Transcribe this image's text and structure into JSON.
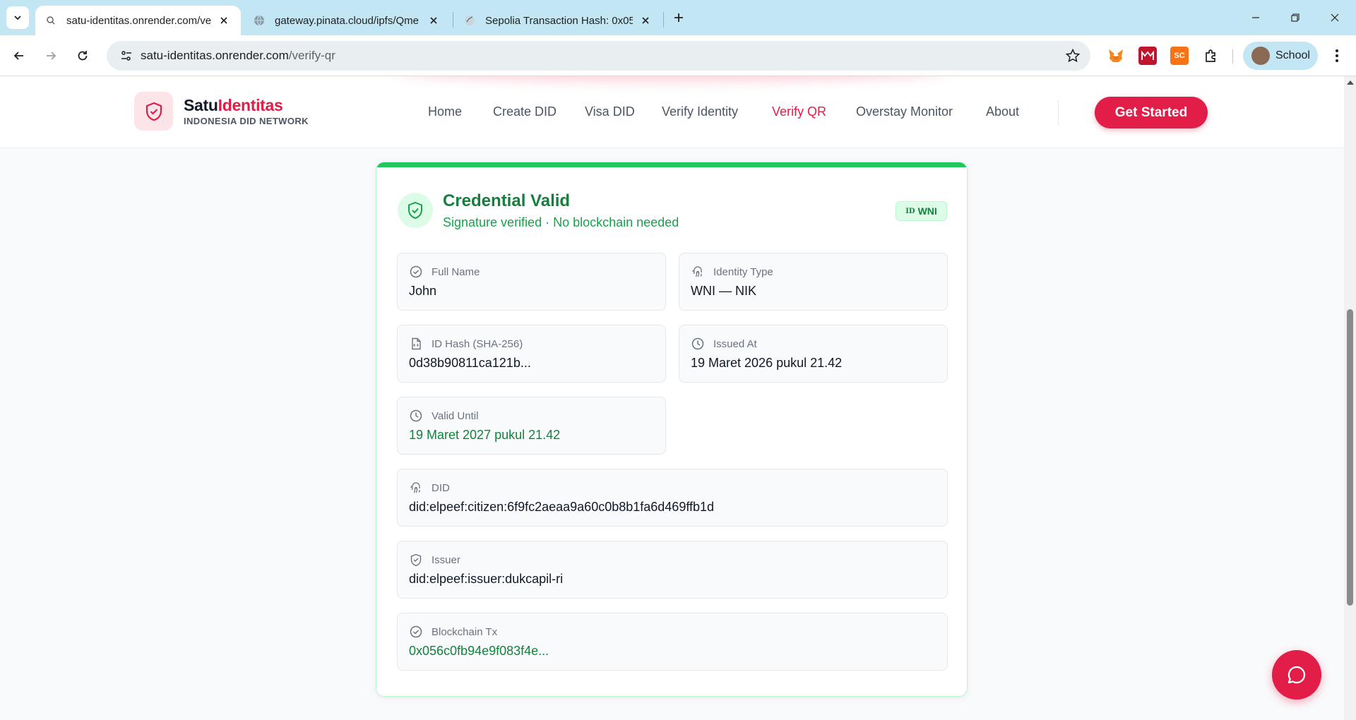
{
  "browser": {
    "tabs": [
      {
        "title": "satu-identitas.onrender.com/ve",
        "active": true
      },
      {
        "title": "gateway.pinata.cloud/ipfs/Qme",
        "active": false
      },
      {
        "title": "Sepolia Transaction Hash: 0x05",
        "active": false
      }
    ],
    "url_host": "satu-identitas.onrender.com",
    "url_path": "/verify-qr",
    "profile_name": "School",
    "extensions": [
      "metamask-icon",
      "m-extension-icon",
      "sc-extension-icon",
      "extensions-puzzle-icon"
    ],
    "ext_sc_label": "SC"
  },
  "site": {
    "brand_part1": "Satu",
    "brand_part2": "Identitas",
    "brand_sub": "INDONESIA DID NETWORK",
    "nav": [
      {
        "label": "Home"
      },
      {
        "label": "Create DID"
      },
      {
        "label": "Visa DID"
      },
      {
        "label": "Verify Identity"
      },
      {
        "label": "Verify QR"
      },
      {
        "label": "Overstay Monitor"
      },
      {
        "label": "About"
      }
    ],
    "cta": "Get Started",
    "accent": "#e11d48"
  },
  "credential": {
    "title": "Credential Valid",
    "subtitle": "Signature verified · No blockchain needed",
    "badge_prefix": "ID",
    "badge_text": "WNI",
    "status_color": "#15803d",
    "fields": [
      {
        "label": "Full Name",
        "value": "John",
        "icon": "check-circle-icon"
      },
      {
        "label": "Identity Type",
        "value": "WNI — NIK",
        "icon": "fingerprint-icon"
      },
      {
        "label": "ID Hash (SHA-256)",
        "value": "0d38b90811ca121b...",
        "icon": "file-code-icon"
      },
      {
        "label": "Issued At",
        "value": "19 Maret 2026 pukul 21.42",
        "icon": "clock-icon"
      },
      {
        "label": "Valid Until",
        "value": "19 Maret 2027 pukul 21.42",
        "icon": "clock-icon"
      },
      {
        "label": "DID",
        "value": "did:elpeef:citizen:6f9fc2aeaa9a60c0b8b1fa6d469ffb1d",
        "icon": "fingerprint-icon"
      },
      {
        "label": "Issuer",
        "value": "did:elpeef:issuer:dukcapil-ri",
        "icon": "shield-icon"
      },
      {
        "label": "Blockchain Tx",
        "value": "0x056c0fb94e9f083f4e...",
        "icon": "check-circle-icon"
      }
    ]
  }
}
